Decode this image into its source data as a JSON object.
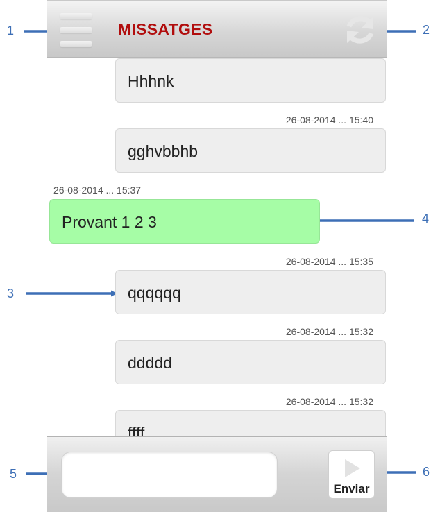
{
  "header": {
    "title": "MISSATGES",
    "menu_icon": "hamburger-menu-icon",
    "refresh_icon": "refresh-icon"
  },
  "messages": [
    {
      "type": "sent",
      "text": "Hhhnk",
      "timestamp": ""
    },
    {
      "type": "sent",
      "text": "gghvbbhb",
      "timestamp": "26-08-2014 ... 15:40"
    },
    {
      "type": "received",
      "text": "Provant 1 2 3",
      "timestamp": "26-08-2014 ... 15:37"
    },
    {
      "type": "sent",
      "text": "qqqqqq",
      "timestamp": "26-08-2014 ... 15:35"
    },
    {
      "type": "sent",
      "text": "ddddd",
      "timestamp": "26-08-2014 ... 15:32"
    },
    {
      "type": "sent",
      "text": "ffff",
      "timestamp": "26-08-2014 ... 15:32"
    }
  ],
  "footer": {
    "input_value": "",
    "input_placeholder": "",
    "send_label": "Enviar",
    "send_icon": "play-arrow-icon"
  },
  "callouts": [
    "1",
    "2",
    "3",
    "4",
    "5",
    "6"
  ],
  "colors": {
    "title": "#b10d0d",
    "received_bubble": "#a6fda6",
    "sent_bubble": "#eeeeee",
    "callout": "#3d6fb6"
  }
}
